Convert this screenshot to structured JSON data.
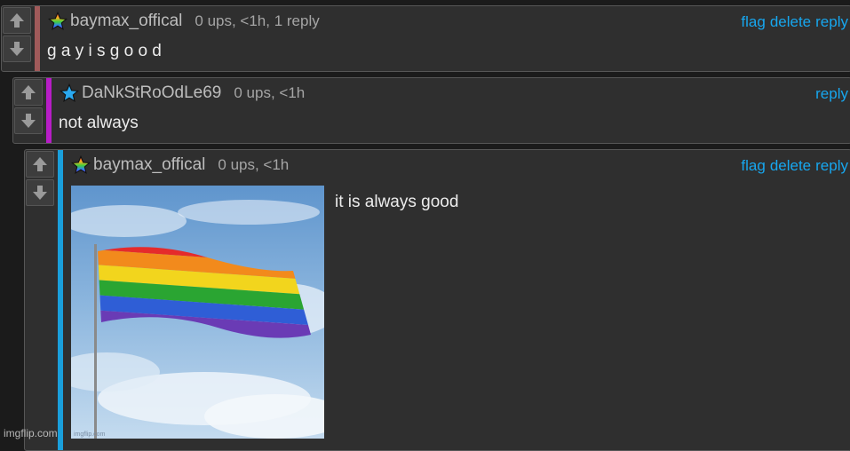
{
  "comments": [
    {
      "username": "baymax_offical",
      "meta": "0 ups, <1h, 1 reply",
      "text": "g a y i s g o o d",
      "actions": [
        "flag",
        "delete",
        "reply"
      ],
      "badge": "rainbow-star-icon"
    },
    {
      "username": "DaNkStRoOdLe69",
      "meta": "0 ups, <1h",
      "text": "not always",
      "actions": [
        "reply"
      ],
      "badge": "blue-star-icon"
    },
    {
      "username": "baymax_offical",
      "meta": "0 ups, <1h",
      "text": "it is always good",
      "actions": [
        "flag",
        "delete",
        "reply"
      ],
      "badge": "rainbow-star-icon",
      "image": "rainbow-flag-image",
      "image_watermark": "imgflip.com"
    }
  ],
  "footer": "imgflip.com",
  "colors": {
    "bar1": "#a15a5a",
    "bar2": "#b71dc7",
    "bar3": "#1a9fdb",
    "link": "#17a7ef",
    "panel": "#2f2f2f"
  }
}
